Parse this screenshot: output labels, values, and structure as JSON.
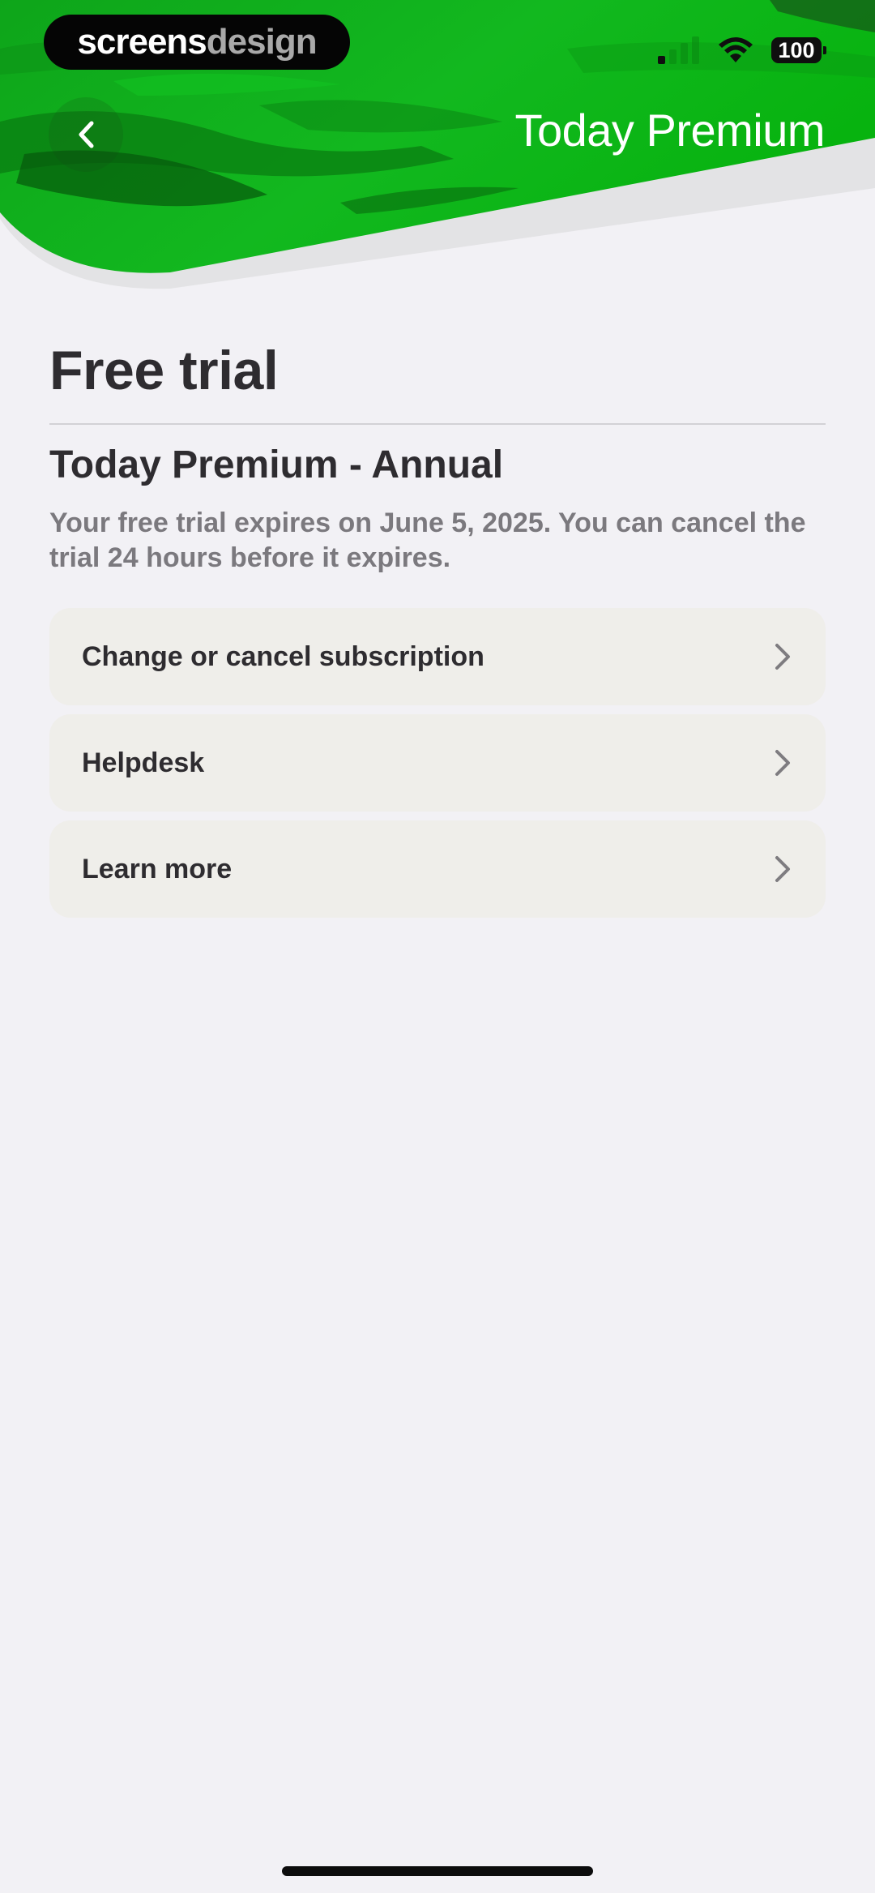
{
  "watermark": {
    "part_a": "screens",
    "part_b": "design"
  },
  "status_bar": {
    "battery_level": "100",
    "signal_icon": "cellular-signal-icon",
    "wifi_icon": "wifi-icon"
  },
  "nav": {
    "title": "Today Premium",
    "back_icon": "chevron-left-icon"
  },
  "page": {
    "title": "Free trial",
    "plan_name": "Today Premium - Annual",
    "plan_description": "Your free trial expires on June 5, 2025. You can cancel the trial 24 hours before it expires."
  },
  "menu": {
    "items": [
      {
        "label": "Change or cancel subscription",
        "icon": "chevron-right-icon"
      },
      {
        "label": "Helpdesk",
        "icon": "chevron-right-icon"
      },
      {
        "label": "Learn more",
        "icon": "chevron-right-icon"
      }
    ]
  },
  "colors": {
    "brand_green": "#0fb81a",
    "background": "#f2f1f5",
    "card": "#efeeea",
    "text_primary": "#2e2c30",
    "text_secondary": "#7b797e"
  }
}
